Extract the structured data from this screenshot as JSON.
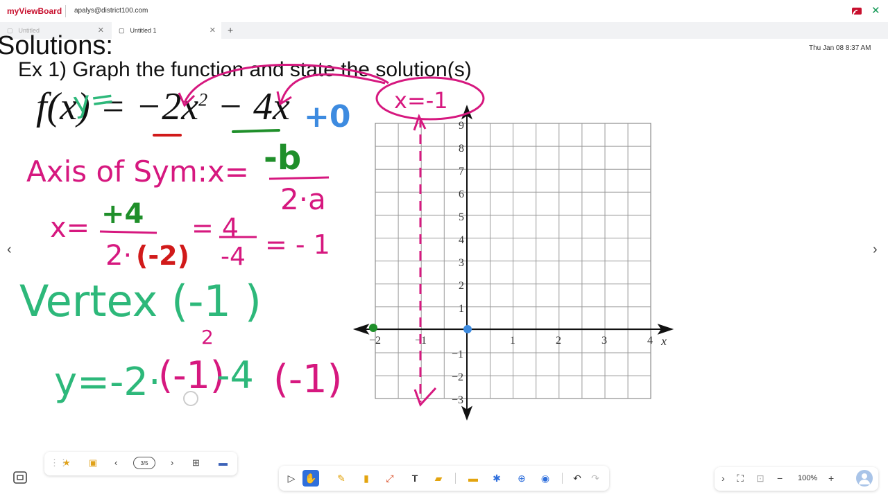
{
  "app": {
    "brand": "myViewBoard",
    "account": "apalys@district100.com"
  },
  "tabs": [
    {
      "label": "Untitled",
      "active": false
    },
    {
      "label": "Untitled 1",
      "active": true
    }
  ],
  "timestamp": "Thu Jan 08 8:37 AM",
  "board": {
    "heading": "Solutions:",
    "subheading": "Ex 1) Graph the function and state the solution(s)",
    "formula_lhs": "f(x) = ",
    "formula_a": "−2x",
    "formula_a_exp": "2",
    "formula_b": " − 4x",
    "handwriting": {
      "y_eq": "y=",
      "plus_zero": "+0",
      "x_eq_neg1": "x=-1",
      "axis_of_sym": "Axis of Sym:x=",
      "neg_b": "-b",
      "two_a": "2·a",
      "x_eq": "x=",
      "plus4": "+4",
      "two_dot": "2·",
      "neg2": "(-2)",
      "eq4": "= 4",
      "neg4": "-4",
      "eq_neg1": "= - 1",
      "vertex": "Vertex (-1    )",
      "y_line_green": "y=-2·",
      "y_line_paren": "(-1)",
      "y_line_sq": "2",
      "y_line_minus4": "-4",
      "y_line_end": "(-1)"
    },
    "graph": {
      "x_ticks": [
        "−2",
        "−1",
        "1",
        "2",
        "3",
        "4"
      ],
      "y_ticks": [
        "9",
        "8",
        "7",
        "6",
        "5",
        "4",
        "3",
        "2",
        "1",
        "−1",
        "−2",
        "−3"
      ],
      "x_label": "x"
    }
  },
  "page_toolbar": {
    "page_counter": "3/5"
  },
  "zoom": {
    "value": "100%"
  },
  "colors": {
    "magenta": "#d6187f",
    "green_ink": "#2db87a",
    "dark_green": "#1f8f2a",
    "red_ink": "#d11a1a",
    "blue_ink": "#3d8be0",
    "brand_red": "#c8102e"
  }
}
